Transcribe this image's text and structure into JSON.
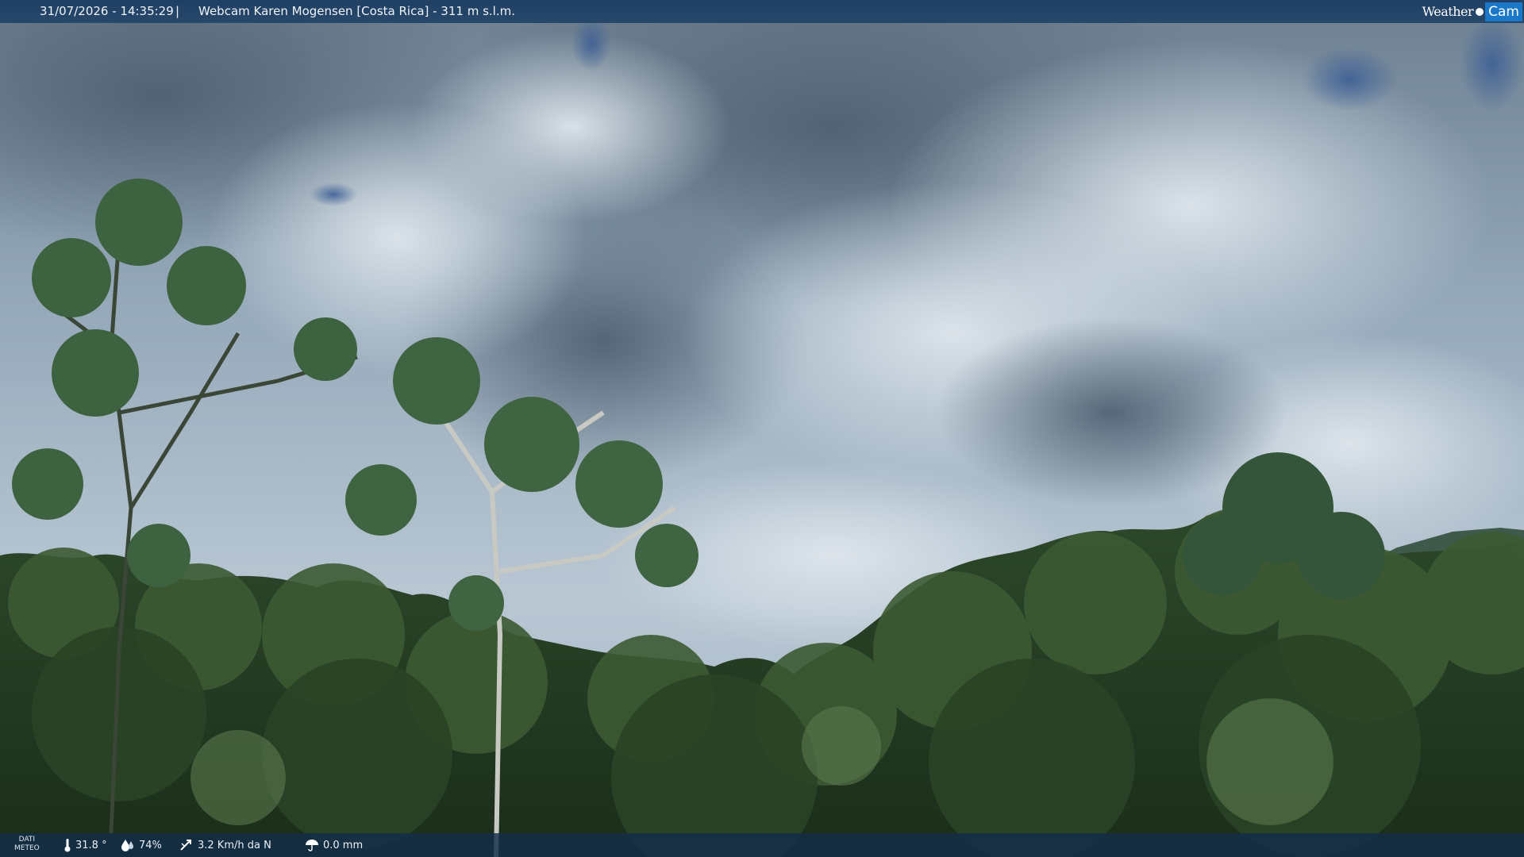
{
  "header": {
    "timestamp": "31/07/2026 - 14:35:29",
    "separator": "|",
    "title": "Webcam Karen Mogensen [Costa Rica] - 311 m s.l.m."
  },
  "logo": {
    "part1": "Weather",
    "part2": "Cam"
  },
  "weather_bar": {
    "label_line1": "DATI",
    "label_line2": "METEO",
    "temperature": "31.8 °",
    "humidity": "74%",
    "wind": "3.2 Km/h da N",
    "rain": "0.0 mm"
  },
  "icons": [
    "thermometer-icon",
    "humidity-drop-icon",
    "wind-icon",
    "rain-umbrella-icon"
  ],
  "colors": {
    "bar": "#22436a",
    "logo_accent": "#1b78c9",
    "sky": "#a9b9c8",
    "forest": "#233a22"
  }
}
